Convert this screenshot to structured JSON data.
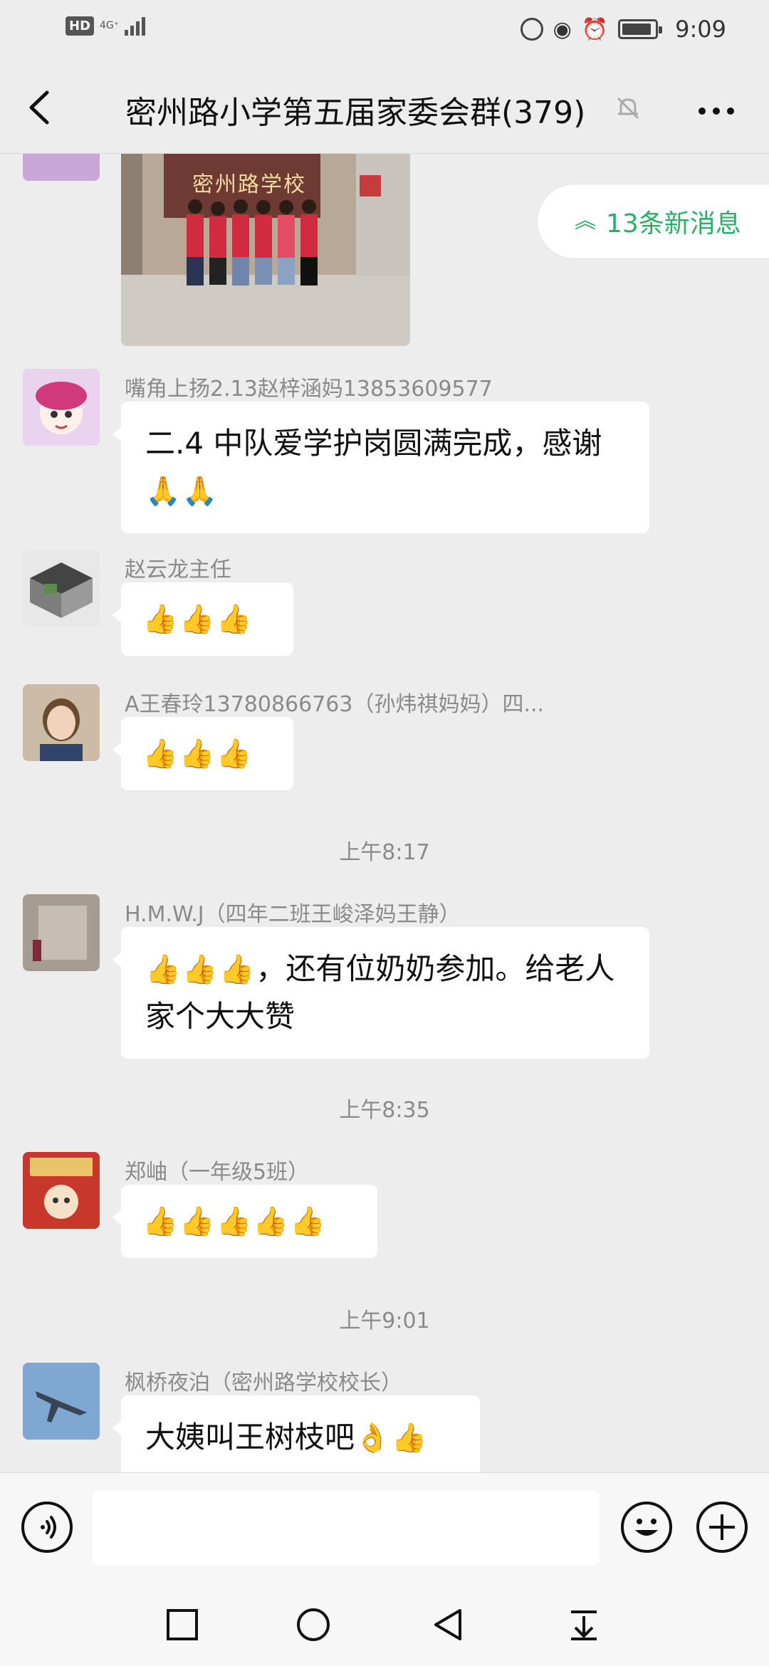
{
  "status_bar": {
    "hd_badge": "HD",
    "network": "4G⁺",
    "time": "9:09"
  },
  "header": {
    "title": "密州路小学第五届家委会群(379)"
  },
  "new_messages": {
    "label": "13条新消息"
  },
  "messages": [
    {
      "sender": "嘴角上扬2.13赵梓涵妈13853609577",
      "text": "二.4 中队爱学护岗圆满完成，感谢",
      "emoji": "🙏🙏"
    },
    {
      "sender": "赵云龙主任",
      "emoji": "👍👍👍"
    },
    {
      "sender": "A王春玲13780866763（孙炜祺妈妈）四...",
      "emoji": "👍👍👍"
    },
    {
      "time": "上午8:17"
    },
    {
      "sender": "H.M.W.J（四年二班王峻泽妈王静）",
      "emoji": "👍👍👍",
      "text": "，还有位奶奶参加。给老人家个大大赞"
    },
    {
      "time": "上午8:35"
    },
    {
      "sender": "郑岫（一年级5班）",
      "emoji": "👍👍👍👍👍"
    },
    {
      "time": "上午9:01"
    },
    {
      "sender": "枫桥夜泊（密州路学校校长）",
      "text": "大姨叫王树枝吧",
      "emoji": "👌👍"
    }
  ],
  "photo_sign": {
    "text": "密州路学校"
  }
}
